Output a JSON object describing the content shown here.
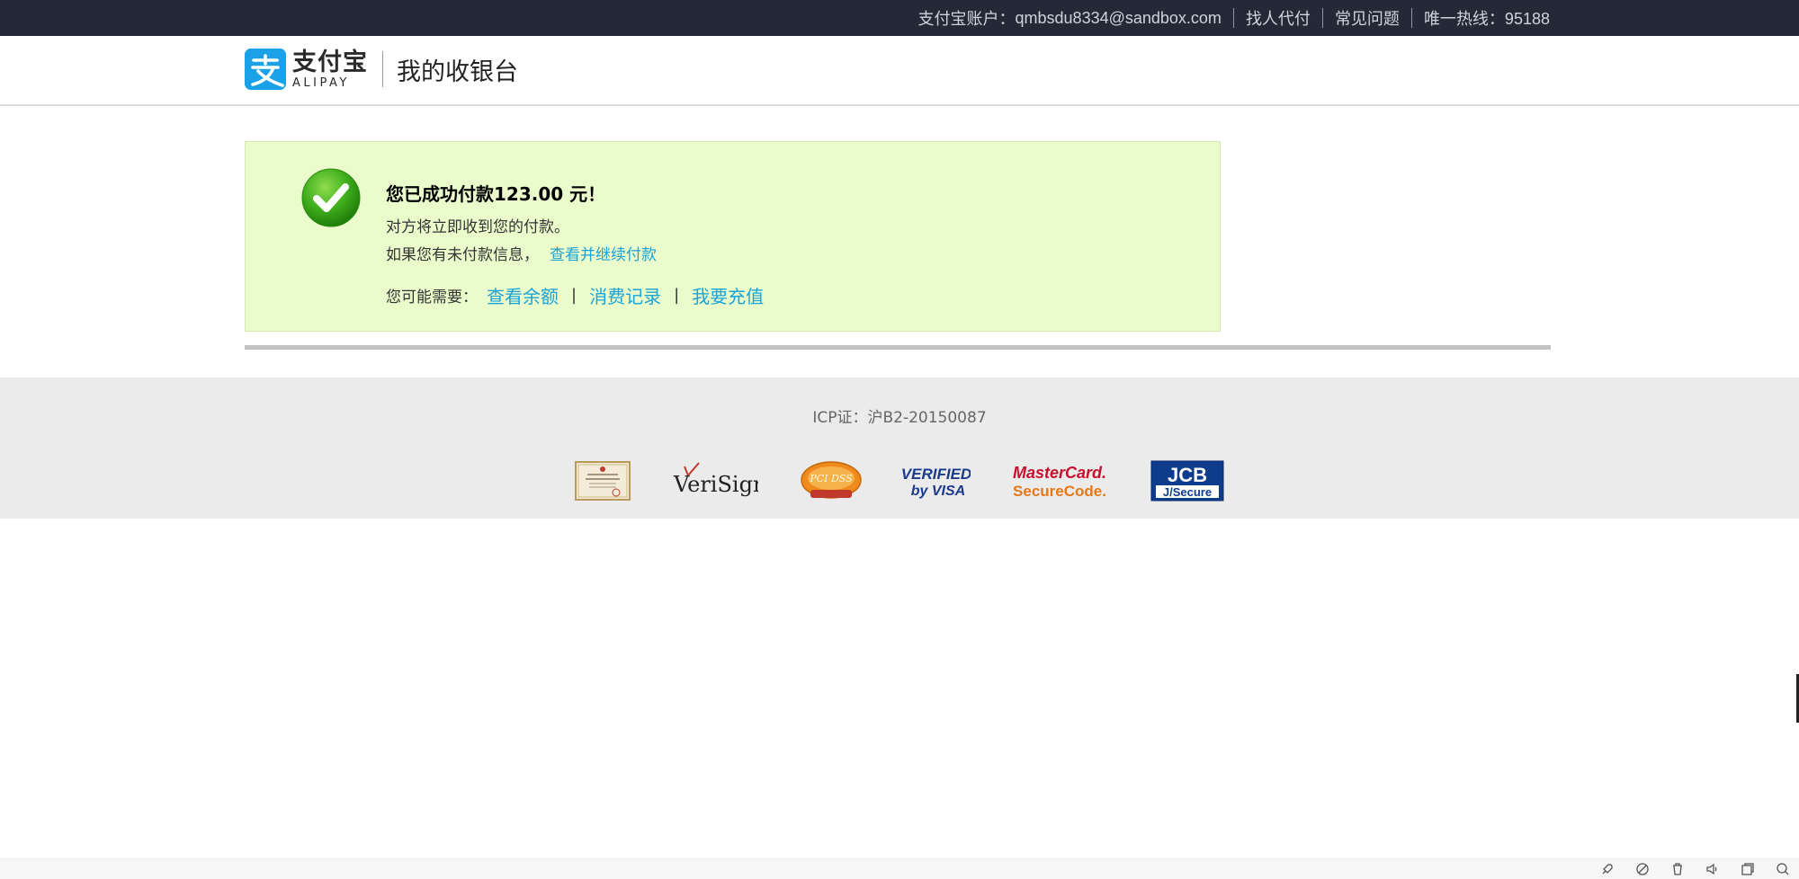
{
  "topbar": {
    "account_label": "支付宝账户：",
    "account_email": "qmbsdu8334@sandbox.com",
    "links": [
      "找人代付",
      "常见问题"
    ],
    "hotline": "唯一热线：95188"
  },
  "header": {
    "logo_cn": "支付宝",
    "logo_en": "ALIPAY",
    "page_title": "我的收银台"
  },
  "success": {
    "title": "您已成功付款123.00 元！",
    "line1": "对方将立即收到您的付款。",
    "line2_text": "如果您有未付款信息，",
    "line2_link": "查看并继续付款",
    "actions_label": "您可能需要：",
    "actions": [
      "查看余额",
      "消费记录",
      "我要充值"
    ],
    "separator": "|"
  },
  "footer": {
    "icp": "ICP证：沪B2-20150087",
    "badges": [
      "license-certificate",
      "VeriSign",
      "PCI DSS",
      "Verified by VISA",
      "MasterCard SecureCode",
      "JCB J/Secure"
    ],
    "verisign_text": "VeriSign",
    "visa_line1": "VERIFIED",
    "visa_line2": "by VISA",
    "mc_line1": "MasterCard.",
    "mc_line2": "SecureCode.",
    "jcb_line1": "JCB",
    "jcb_line2": "J/Secure",
    "pci_text": "PCI DSS"
  },
  "colors": {
    "topbar_bg": "#232937",
    "success_bg": "#ebfccc",
    "link": "#1ba3d8",
    "footer_bg": "#ebebeb",
    "alipay_blue": "#1aa1e8"
  }
}
